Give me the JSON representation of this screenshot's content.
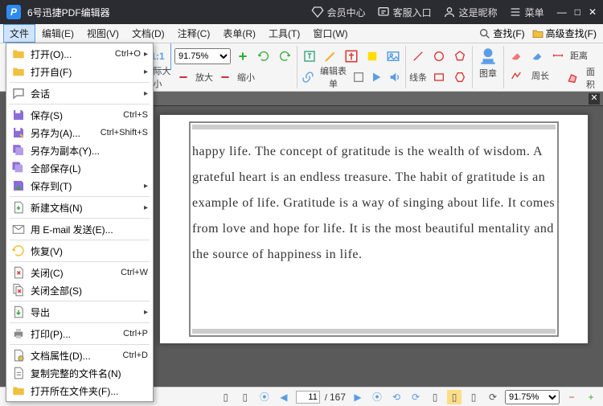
{
  "titlebar": {
    "app_title": "6号迅捷PDF编辑器",
    "member": "会员中心",
    "support": "客服入口",
    "nickname": "这是昵称",
    "menu": "菜单"
  },
  "menubar": {
    "items": [
      "文件",
      "编辑(E)",
      "视图(V)",
      "文档(D)",
      "注释(C)",
      "表单(R)",
      "工具(T)",
      "窗口(W)"
    ],
    "find": "查找(F)",
    "adv_find": "高级查找(F)"
  },
  "toolbar": {
    "actual_size": "实际大小",
    "zoom_in": "放大",
    "zoom_out": "缩小",
    "zoom_value": "91.75%",
    "edit_form": "编辑表单",
    "lines": "线条",
    "gallery": "图章",
    "distance": "距离",
    "perimeter": "周长",
    "area": "面积"
  },
  "file_menu": {
    "open": {
      "label": "打开(O)...",
      "shortcut": "Ctrl+O",
      "arrow": true
    },
    "open_from": {
      "label": "打开自(F)",
      "arrow": true
    },
    "session": {
      "label": "会话",
      "arrow": true
    },
    "save": {
      "label": "保存(S)",
      "shortcut": "Ctrl+S"
    },
    "save_as": {
      "label": "另存为(A)...",
      "shortcut": "Ctrl+Shift+S"
    },
    "save_copy": {
      "label": "另存为副本(Y)..."
    },
    "save_all": {
      "label": "全部保存(L)"
    },
    "save_to": {
      "label": "保存到(T)",
      "arrow": true
    },
    "new_doc": {
      "label": "新建文档(N)",
      "arrow": true
    },
    "email": {
      "label": "用 E-mail 发送(E)..."
    },
    "restore": {
      "label": "恢复(V)"
    },
    "close": {
      "label": "关闭(C)",
      "shortcut": "Ctrl+W"
    },
    "close_all": {
      "label": "关闭全部(S)"
    },
    "export": {
      "label": "导出",
      "arrow": true
    },
    "print": {
      "label": "打印(P)...",
      "shortcut": "Ctrl+P"
    },
    "doc_props": {
      "label": "文档属性(D)...",
      "shortcut": "Ctrl+D"
    },
    "copy_filename": {
      "label": "复制完整的文件名(N)"
    },
    "open_folder": {
      "label": "打开所在文件夹(F)..."
    }
  },
  "content": {
    "text": "happy life. The concept of gratitude is the wealth of wisdom. A grateful heart is an endless treasure. The habit of gratitude is an example of life. Gratitude is a way of singing about life. It comes from love and hope for life. It is the most beautiful mentality and the source of happiness in life."
  },
  "statusbar": {
    "page": "11",
    "total": "167",
    "zoom": "91.75%"
  }
}
